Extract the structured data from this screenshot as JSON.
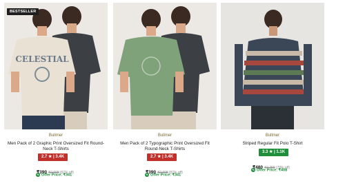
{
  "products": [
    {
      "badge": "BESTSELLER",
      "brand": "Bullmer",
      "name_line1": "Men Pack of 2 Graphic Print Oversized Fit Round-",
      "name_line2": "Neck T-Shirts",
      "rating": "2.7 ★ | 3.4K",
      "rating_color": "#c2302c",
      "price": "₹390",
      "mrp": "₹2,998",
      "discount": "(87% off)",
      "offer": "Offer Price: ₹341"
    },
    {
      "brand": "Bullmer",
      "name_line1": "Men Pack of 2 Typographic Print Oversized Fit",
      "name_line2": "Round-Neck T-Shirts",
      "rating": "2.7 ★ | 3.4K",
      "rating_color": "#c2302c",
      "price": "₹390",
      "mrp": "₹2,998",
      "discount": "(87% off)",
      "offer": "Offer Price: ₹341"
    },
    {
      "brand": "Bullmer",
      "name_line1": "Striped Regular Fit Polo T-Shirt",
      "rating": "3.3 ★ | 1.1K",
      "rating_color": "#1f8f3c",
      "price": "₹480",
      "mrp": "₹2,299",
      "discount": "(79% off)",
      "offer": "Offer Price: ₹408"
    }
  ],
  "colors": {
    "offer_green": "#1a8a37",
    "brand_text": "#7a6a2f"
  },
  "icons": [
    "offer-tag-icon"
  ]
}
